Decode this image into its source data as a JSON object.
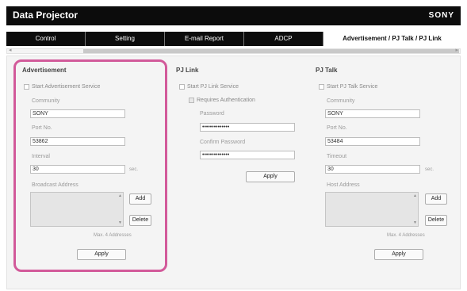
{
  "app": {
    "title": "Data Projector",
    "brand": "SONY"
  },
  "tabs": [
    {
      "label": "Control"
    },
    {
      "label": "Setting"
    },
    {
      "label": "E-mail Report"
    },
    {
      "label": "ADCP"
    },
    {
      "label": "Advertisement / PJ Talk / PJ Link"
    }
  ],
  "advertisement": {
    "title": "Advertisement",
    "start_label": "Start Advertisement Service",
    "community_label": "Community",
    "community_value": "SONY",
    "port_label": "Port No.",
    "port_value": "53862",
    "interval_label": "Interval",
    "interval_value": "30",
    "interval_unit": "sec.",
    "broadcast_label": "Broadcast Address",
    "add_label": "Add",
    "delete_label": "Delete",
    "max_note": "Max. 4 Addresses",
    "apply_label": "Apply"
  },
  "pjlink": {
    "title": "PJ Link",
    "start_label": "Start PJ Link Service",
    "auth_label": "Requires Authentication",
    "password_label": "Password",
    "password_value": "••••••••••••••",
    "confirm_label": "Confirm Password",
    "confirm_value": "••••••••••••••",
    "apply_label": "Apply"
  },
  "pjtalk": {
    "title": "PJ Talk",
    "start_label": "Start PJ Talk Service",
    "community_label": "Community",
    "community_value": "SONY",
    "port_label": "Port No.",
    "port_value": "53484",
    "timeout_label": "Timeout",
    "timeout_value": "30",
    "timeout_unit": "sec.",
    "host_label": "Host Address",
    "add_label": "Add",
    "delete_label": "Delete",
    "max_note": "Max. 4 Addresses",
    "apply_label": "Apply"
  }
}
